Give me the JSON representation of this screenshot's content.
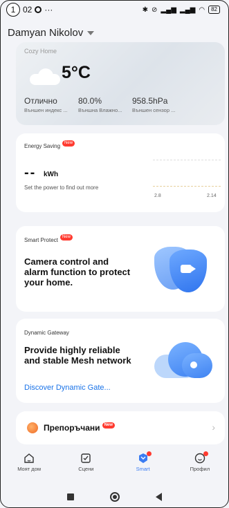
{
  "status_bar": {
    "indicator_number": "1",
    "time_fragment": "02",
    "dots": "···",
    "battery": "82"
  },
  "header": {
    "account_name": "Damyan Nikolov"
  },
  "weather": {
    "home_name": "Cozy Home",
    "temperature": "5°C",
    "stats": [
      {
        "value": "Отлично",
        "label": "Външен индекс ..."
      },
      {
        "value": "80.0%",
        "label": "Външна Влажно..."
      },
      {
        "value": "958.5hPa",
        "label": "Външен сензор ..."
      }
    ]
  },
  "energy": {
    "tag": "Energy Saving",
    "new_badge": "New",
    "value": "--",
    "unit": "kWh",
    "hint": "Set the power to find out more",
    "axis_start": "2.8",
    "axis_end": "2.14"
  },
  "protect": {
    "tag": "Smart Protect",
    "new_badge": "New",
    "title": "Camera control and alarm function to protect your home."
  },
  "gateway": {
    "tag": "Dynamic Gateway",
    "title": "Provide highly reliable and stable Mesh network",
    "link": "Discover Dynamic Gate..."
  },
  "recommended": {
    "label": "Препоръчани",
    "new_badge": "New"
  },
  "bottom_nav": {
    "items": [
      {
        "label": "Моят дом"
      },
      {
        "label": "Сцени"
      },
      {
        "label": "Smart"
      },
      {
        "label": "Профил"
      }
    ]
  },
  "colors": {
    "accent": "#3b7cf2",
    "badge": "#ff3b30",
    "link": "#1a73e8"
  }
}
